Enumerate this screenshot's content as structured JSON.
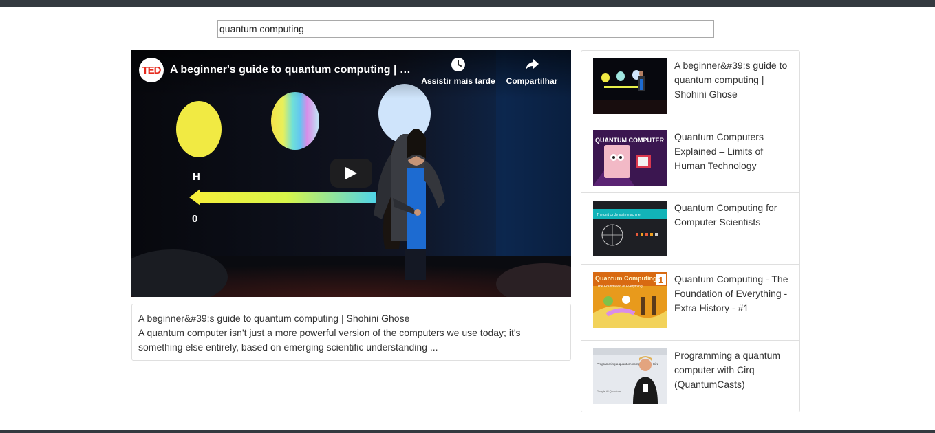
{
  "search": {
    "value": "quantum computing"
  },
  "player": {
    "channel_logo": "TED",
    "title": "A beginner's guide to quantum computing | Shohini Ghose",
    "watch_later_label": "Assistir mais tarde",
    "share_label": "Compartilhar",
    "slide_letters": [
      "H",
      "0"
    ],
    "icons": [
      "clock-icon",
      "share-arrow-icon",
      "play-icon"
    ]
  },
  "description": {
    "title": "A beginner&#39;s guide to quantum computing | Shohini Ghose",
    "text": "A quantum computer isn't just a more powerful version of the computers we use today; it's something else entirely, based on emerging scientific understanding ..."
  },
  "videos": [
    {
      "title": "A beginner&#39;s guide to quantum computing | Shohini Ghose"
    },
    {
      "title": "Quantum Computers Explained – Limits of Human Technology",
      "thumb_text": "QUANTUM COMPUTER"
    },
    {
      "title": "Quantum Computing for Computer Scientists",
      "thumb_text": "The unit circle state machine"
    },
    {
      "title": "Quantum Computing - The Foundation of Everything - Extra History - #1",
      "thumb_text": "Quantum Computing",
      "thumb_subtext": "The Foundation of Everything",
      "thumb_number": "1"
    },
    {
      "title": "Programming a quantum computer with Cirq (QuantumCasts)",
      "thumb_text": "Programming a quantum computer with Cirq",
      "thumb_brand": "Google AI Quantum"
    }
  ],
  "colors": {
    "topbar": "#343a40",
    "ted_red": "#e62b1e",
    "border": "#dfdfdf",
    "text": "#333333"
  }
}
